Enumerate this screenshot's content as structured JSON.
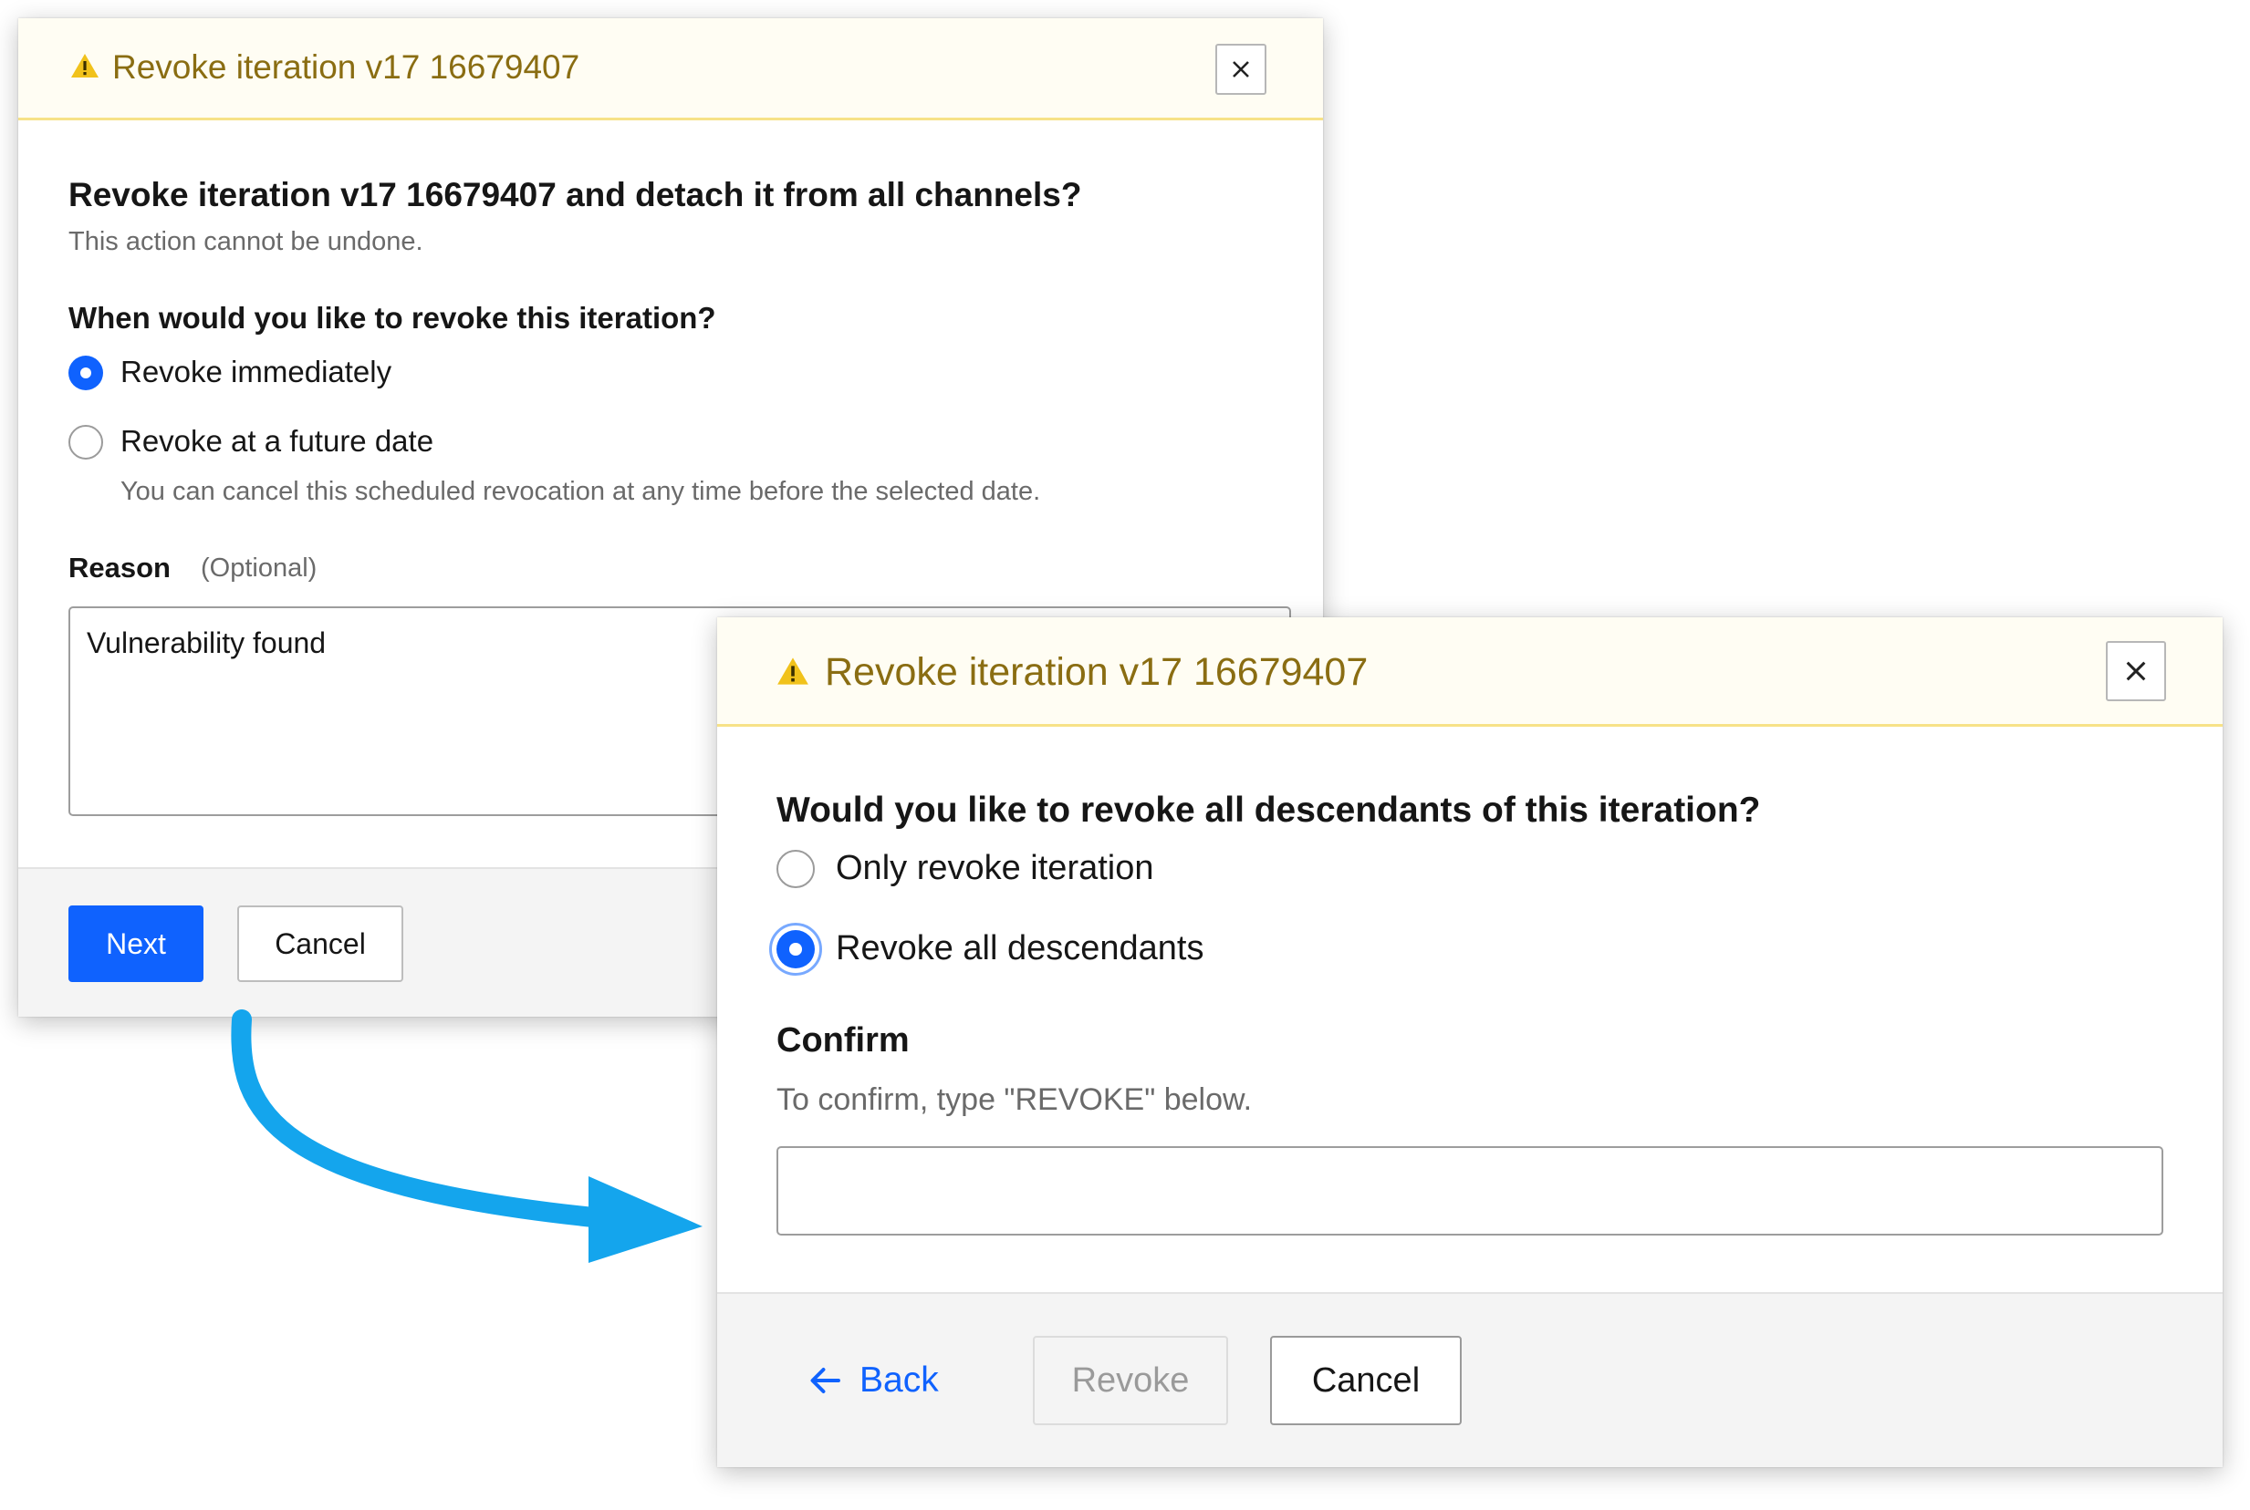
{
  "dialog1": {
    "header_title": "Revoke iteration v17 16679407",
    "heading": "Revoke iteration v17 16679407 and detach it from all channels?",
    "subtext": "This action cannot be undone.",
    "question": "When would you like to revoke this iteration?",
    "options": [
      {
        "label": "Revoke immediately",
        "selected": true
      },
      {
        "label": "Revoke at a future date",
        "selected": false,
        "helper": "You can cancel this scheduled revocation at any time before the selected date."
      }
    ],
    "reason_label": "Reason",
    "reason_optional": "(Optional)",
    "reason_value": "Vulnerability found",
    "next_label": "Next",
    "cancel_label": "Cancel"
  },
  "dialog2": {
    "header_title": "Revoke iteration v17 16679407",
    "question": "Would you like to revoke all descendants of this iteration?",
    "options": [
      {
        "label": "Only revoke iteration",
        "selected": false
      },
      {
        "label": "Revoke all descendants",
        "selected": true
      }
    ],
    "confirm_label": "Confirm",
    "confirm_help": "To confirm, type \"REVOKE\" below.",
    "confirm_value": "",
    "back_label": "Back",
    "revoke_label": "Revoke",
    "cancel_label": "Cancel"
  },
  "colors": {
    "primary": "#0f62fe",
    "warning_icon": "#f1c21b",
    "header_title": "#8a6d12",
    "arrow": "#14a5ed"
  },
  "icons": {
    "warning": "warning-icon",
    "close": "close-icon",
    "back": "arrow-left-icon",
    "flow": "curved-arrow-icon"
  }
}
